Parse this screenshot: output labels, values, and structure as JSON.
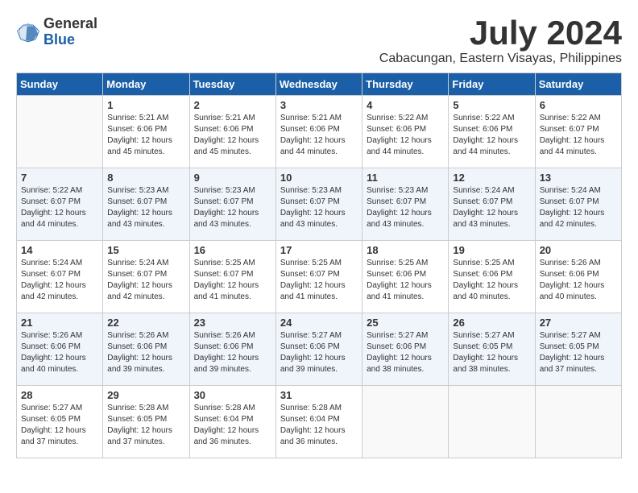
{
  "header": {
    "logo_general": "General",
    "logo_blue": "Blue",
    "month_year": "July 2024",
    "location": "Cabacungan, Eastern Visayas, Philippines"
  },
  "days_of_week": [
    "Sunday",
    "Monday",
    "Tuesday",
    "Wednesday",
    "Thursday",
    "Friday",
    "Saturday"
  ],
  "weeks": [
    [
      {
        "day": "",
        "info": ""
      },
      {
        "day": "1",
        "info": "Sunrise: 5:21 AM\nSunset: 6:06 PM\nDaylight: 12 hours\nand 45 minutes."
      },
      {
        "day": "2",
        "info": "Sunrise: 5:21 AM\nSunset: 6:06 PM\nDaylight: 12 hours\nand 45 minutes."
      },
      {
        "day": "3",
        "info": "Sunrise: 5:21 AM\nSunset: 6:06 PM\nDaylight: 12 hours\nand 44 minutes."
      },
      {
        "day": "4",
        "info": "Sunrise: 5:22 AM\nSunset: 6:06 PM\nDaylight: 12 hours\nand 44 minutes."
      },
      {
        "day": "5",
        "info": "Sunrise: 5:22 AM\nSunset: 6:06 PM\nDaylight: 12 hours\nand 44 minutes."
      },
      {
        "day": "6",
        "info": "Sunrise: 5:22 AM\nSunset: 6:07 PM\nDaylight: 12 hours\nand 44 minutes."
      }
    ],
    [
      {
        "day": "7",
        "info": "Sunrise: 5:22 AM\nSunset: 6:07 PM\nDaylight: 12 hours\nand 44 minutes."
      },
      {
        "day": "8",
        "info": "Sunrise: 5:23 AM\nSunset: 6:07 PM\nDaylight: 12 hours\nand 43 minutes."
      },
      {
        "day": "9",
        "info": "Sunrise: 5:23 AM\nSunset: 6:07 PM\nDaylight: 12 hours\nand 43 minutes."
      },
      {
        "day": "10",
        "info": "Sunrise: 5:23 AM\nSunset: 6:07 PM\nDaylight: 12 hours\nand 43 minutes."
      },
      {
        "day": "11",
        "info": "Sunrise: 5:23 AM\nSunset: 6:07 PM\nDaylight: 12 hours\nand 43 minutes."
      },
      {
        "day": "12",
        "info": "Sunrise: 5:24 AM\nSunset: 6:07 PM\nDaylight: 12 hours\nand 43 minutes."
      },
      {
        "day": "13",
        "info": "Sunrise: 5:24 AM\nSunset: 6:07 PM\nDaylight: 12 hours\nand 42 minutes."
      }
    ],
    [
      {
        "day": "14",
        "info": "Sunrise: 5:24 AM\nSunset: 6:07 PM\nDaylight: 12 hours\nand 42 minutes."
      },
      {
        "day": "15",
        "info": "Sunrise: 5:24 AM\nSunset: 6:07 PM\nDaylight: 12 hours\nand 42 minutes."
      },
      {
        "day": "16",
        "info": "Sunrise: 5:25 AM\nSunset: 6:07 PM\nDaylight: 12 hours\nand 41 minutes."
      },
      {
        "day": "17",
        "info": "Sunrise: 5:25 AM\nSunset: 6:07 PM\nDaylight: 12 hours\nand 41 minutes."
      },
      {
        "day": "18",
        "info": "Sunrise: 5:25 AM\nSunset: 6:06 PM\nDaylight: 12 hours\nand 41 minutes."
      },
      {
        "day": "19",
        "info": "Sunrise: 5:25 AM\nSunset: 6:06 PM\nDaylight: 12 hours\nand 40 minutes."
      },
      {
        "day": "20",
        "info": "Sunrise: 5:26 AM\nSunset: 6:06 PM\nDaylight: 12 hours\nand 40 minutes."
      }
    ],
    [
      {
        "day": "21",
        "info": "Sunrise: 5:26 AM\nSunset: 6:06 PM\nDaylight: 12 hours\nand 40 minutes."
      },
      {
        "day": "22",
        "info": "Sunrise: 5:26 AM\nSunset: 6:06 PM\nDaylight: 12 hours\nand 39 minutes."
      },
      {
        "day": "23",
        "info": "Sunrise: 5:26 AM\nSunset: 6:06 PM\nDaylight: 12 hours\nand 39 minutes."
      },
      {
        "day": "24",
        "info": "Sunrise: 5:27 AM\nSunset: 6:06 PM\nDaylight: 12 hours\nand 39 minutes."
      },
      {
        "day": "25",
        "info": "Sunrise: 5:27 AM\nSunset: 6:06 PM\nDaylight: 12 hours\nand 38 minutes."
      },
      {
        "day": "26",
        "info": "Sunrise: 5:27 AM\nSunset: 6:05 PM\nDaylight: 12 hours\nand 38 minutes."
      },
      {
        "day": "27",
        "info": "Sunrise: 5:27 AM\nSunset: 6:05 PM\nDaylight: 12 hours\nand 37 minutes."
      }
    ],
    [
      {
        "day": "28",
        "info": "Sunrise: 5:27 AM\nSunset: 6:05 PM\nDaylight: 12 hours\nand 37 minutes."
      },
      {
        "day": "29",
        "info": "Sunrise: 5:28 AM\nSunset: 6:05 PM\nDaylight: 12 hours\nand 37 minutes."
      },
      {
        "day": "30",
        "info": "Sunrise: 5:28 AM\nSunset: 6:04 PM\nDaylight: 12 hours\nand 36 minutes."
      },
      {
        "day": "31",
        "info": "Sunrise: 5:28 AM\nSunset: 6:04 PM\nDaylight: 12 hours\nand 36 minutes."
      },
      {
        "day": "",
        "info": ""
      },
      {
        "day": "",
        "info": ""
      },
      {
        "day": "",
        "info": ""
      }
    ]
  ]
}
